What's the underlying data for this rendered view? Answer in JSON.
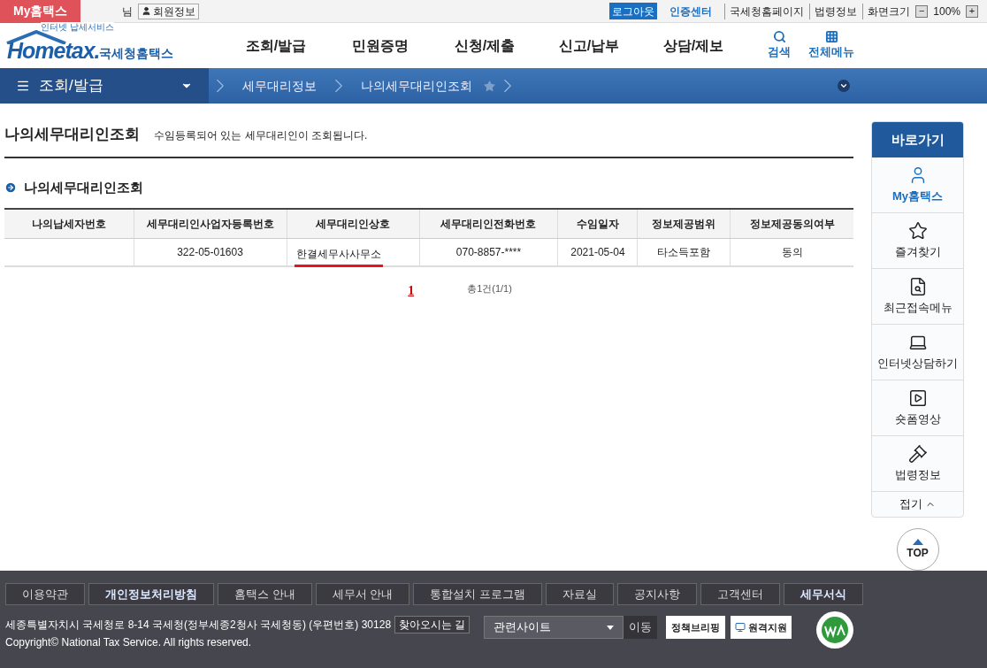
{
  "top_bar": {
    "my_hometax": "My홈택스",
    "suffix": "님",
    "member_info": "회원정보",
    "logout": "로그아웃",
    "cert_center": "인증센터",
    "links": [
      "국세청홈페이지",
      "법령정보"
    ],
    "zoom_label": "화면크기",
    "zoom_out": "−",
    "zoom_value": "100%",
    "zoom_in": "+"
  },
  "header": {
    "logo_tagline": "인터넷 납세서비스",
    "logo_word": "Hometax.",
    "logo_name": "국세청홈택스",
    "menu": [
      {
        "label": "조회/발급",
        "selected": false
      },
      {
        "label": "민원증명",
        "selected": false
      },
      {
        "label": "신청/제출",
        "selected": false
      },
      {
        "label": "신고/납부",
        "selected": false
      },
      {
        "label": "상담/제보",
        "selected": false
      }
    ],
    "search": "검색",
    "all_menu": "전체메뉴"
  },
  "breadcrumb": {
    "section": "조회/발급",
    "items": [
      "세무대리정보",
      "나의세무대리인조회"
    ],
    "favorite": false
  },
  "page": {
    "title": "나의세무대리인조회",
    "description": "수임등록되어 있는 세무대리인이 조회됩니다.",
    "section_title": "나의세무대리인조회",
    "table": {
      "columns": [
        "나의납세자번호",
        "세무대리인사업자등록번호",
        "세무대리인상호",
        "세무대리인전화번호",
        "수임일자",
        "정보제공범위",
        "정보제공동의여부"
      ],
      "rows": [
        {
          "cells": [
            "",
            "322-05-01603",
            "한결세무사사무소",
            "070-8857-****",
            "2021-05-04",
            "타소득포함",
            "동의"
          ],
          "underlined": true
        }
      ]
    },
    "pagination": {
      "pages": [
        {
          "label": "1",
          "selected": true
        }
      ],
      "total": "총1건(1/1)"
    }
  },
  "quick_menu": {
    "title": "바로가기",
    "items": [
      {
        "label": "My홈택스",
        "kind": "user",
        "selected": true
      },
      {
        "label": "즐겨찾기",
        "kind": "star",
        "selected": false
      },
      {
        "label": "최근접속메뉴",
        "kind": "recent",
        "selected": false
      },
      {
        "label": "인터넷상담하기",
        "kind": "laptop",
        "selected": false
      },
      {
        "label": "숏폼영상",
        "kind": "video",
        "selected": false
      },
      {
        "label": "법령정보",
        "kind": "gavel",
        "selected": false
      }
    ],
    "collapse": "접기",
    "top": "TOP"
  },
  "footer": {
    "links": [
      {
        "label": "이용약관",
        "bold": false
      },
      {
        "label": "개인정보처리방침",
        "bold": true
      },
      {
        "label": "홈택스 안내",
        "bold": false
      },
      {
        "label": "세무서 안내",
        "bold": false
      },
      {
        "label": "통합설치 프로그램",
        "bold": false
      },
      {
        "label": "자료실",
        "bold": false
      },
      {
        "label": "공지사항",
        "bold": false
      },
      {
        "label": "고객센터",
        "bold": false
      },
      {
        "label": "세무서식",
        "bold": true
      }
    ],
    "address": "세종특별자치시 국세청로 8-14 국세청(정부세종2청사 국세청동) (우편번호) 30128",
    "directions": "찾아오시는 길",
    "copyright": "Copyright© National Tax Service. All rights reserved.",
    "related_sites": "관련사이트",
    "go": "이동",
    "policy_briefing": "정책브리핑",
    "remote_support": "원격지원"
  }
}
